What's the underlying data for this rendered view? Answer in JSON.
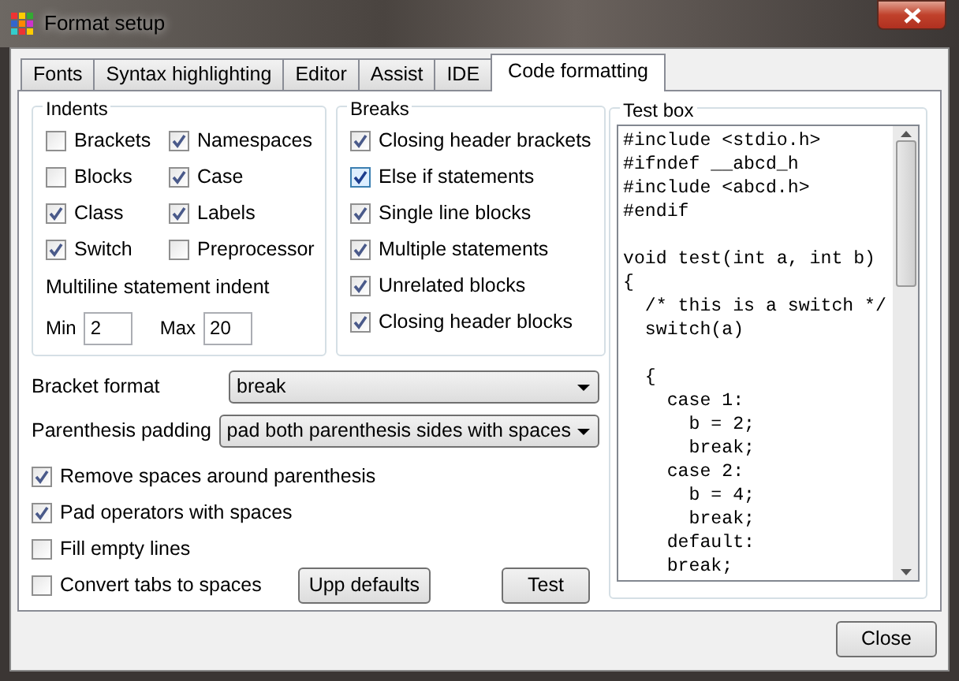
{
  "window": {
    "title": "Format setup"
  },
  "tabs": [
    {
      "label": "Fonts",
      "selected": false
    },
    {
      "label": "Syntax highlighting",
      "selected": false
    },
    {
      "label": "Editor",
      "selected": false
    },
    {
      "label": "Assist",
      "selected": false
    },
    {
      "label": "IDE",
      "selected": false
    },
    {
      "label": "Code formatting",
      "selected": true
    }
  ],
  "indents": {
    "title": "Indents",
    "options": [
      {
        "label": "Brackets",
        "checked": false
      },
      {
        "label": "Namespaces",
        "checked": true
      },
      {
        "label": "Blocks",
        "checked": false
      },
      {
        "label": "Case",
        "checked": true
      },
      {
        "label": "Class",
        "checked": true
      },
      {
        "label": "Labels",
        "checked": true
      },
      {
        "label": "Switch",
        "checked": true
      },
      {
        "label": "Preprocessor",
        "checked": false
      }
    ],
    "multiline_label": "Multiline statement indent",
    "min": {
      "label": "Min",
      "value": "2"
    },
    "max": {
      "label": "Max",
      "value": "20"
    }
  },
  "breaks": {
    "title": "Breaks",
    "options": [
      {
        "label": "Closing header brackets",
        "checked": true
      },
      {
        "label": "Else if statements",
        "checked": true,
        "focused": true
      },
      {
        "label": "Single line blocks",
        "checked": true
      },
      {
        "label": "Multiple statements",
        "checked": true
      },
      {
        "label": "Unrelated blocks",
        "checked": true
      },
      {
        "label": "Closing header blocks",
        "checked": true
      }
    ]
  },
  "dropdowns": [
    {
      "label": "Bracket format",
      "value": "break"
    },
    {
      "label": "Parenthesis padding",
      "value": "pad both parenthesis sides with spaces"
    }
  ],
  "options": [
    {
      "label": "Remove spaces around parenthesis",
      "checked": true
    },
    {
      "label": "Pad operators with spaces",
      "checked": true
    },
    {
      "label": "Fill empty lines",
      "checked": false
    },
    {
      "label": "Convert tabs to spaces",
      "checked": false
    }
  ],
  "buttons": [
    "Upp defaults",
    "Test"
  ],
  "test_box": {
    "title": "Test box",
    "code": "#include <stdio.h>\n#ifndef __abcd_h\n#include <abcd.h>\n#endif\n\nvoid test(int a, int b)\n{\n  /* this is a switch */\n  switch(a)\n\n  {\n    case 1:\n      b = 2;\n      break;\n    case 2:\n      b = 4;\n      break;\n    default:\n    break;"
  },
  "footer_button": "Close"
}
